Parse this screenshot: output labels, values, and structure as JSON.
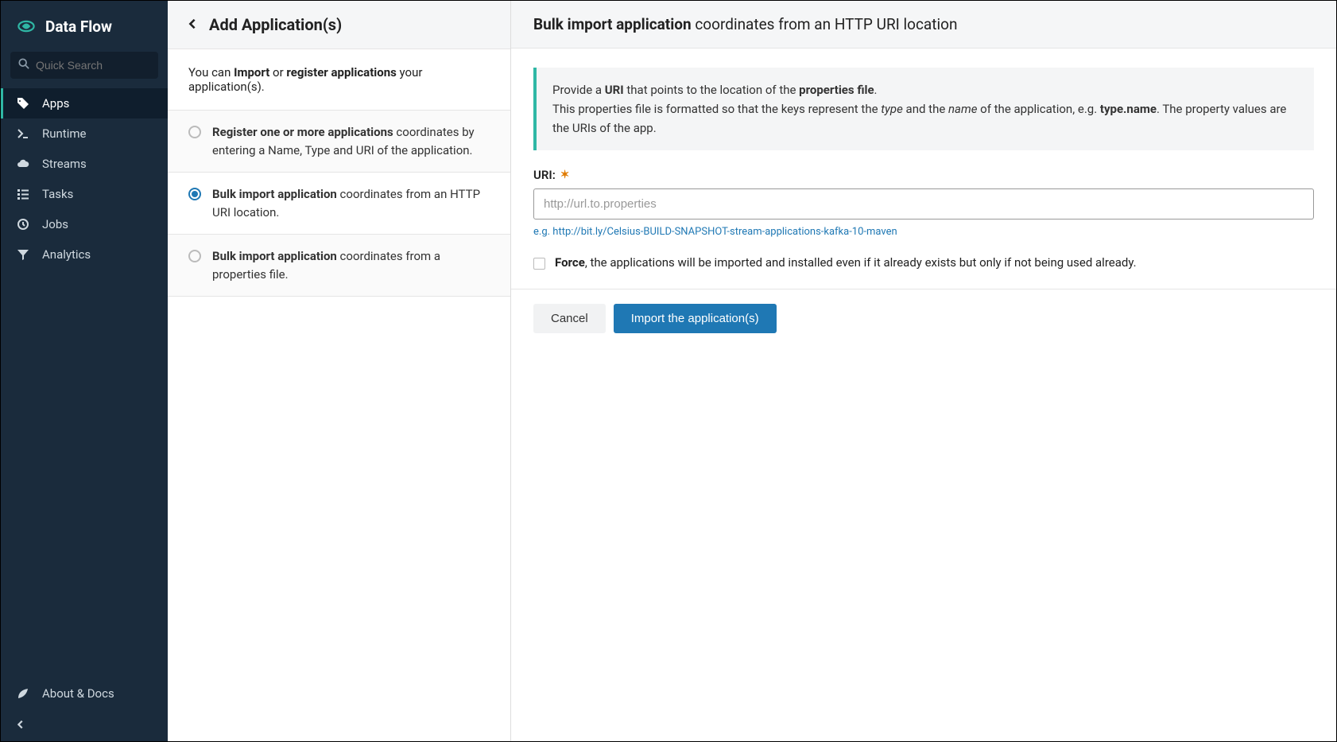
{
  "sidebar": {
    "title": "Data Flow",
    "search_placeholder": "Quick Search",
    "nav": [
      {
        "label": "Apps",
        "icon": "tags"
      },
      {
        "label": "Runtime",
        "icon": "prompt"
      },
      {
        "label": "Streams",
        "icon": "cloud"
      },
      {
        "label": "Tasks",
        "icon": "list"
      },
      {
        "label": "Jobs",
        "icon": "clock"
      },
      {
        "label": "Analytics",
        "icon": "filter"
      }
    ],
    "footer": {
      "label": "About & Docs"
    }
  },
  "left": {
    "title": "Add Application(s)",
    "intro_prefix": "You can ",
    "intro_bold1": "Import",
    "intro_mid": " or ",
    "intro_bold2": "register applications",
    "intro_suffix": " your application(s).",
    "options": [
      {
        "bold": "Register one or more applications",
        "rest": " coordinates by entering a Name, Type and URI of the application."
      },
      {
        "bold": "Bulk import application",
        "rest": " coordinates from an HTTP URI location."
      },
      {
        "bold": "Bulk import application",
        "rest": " coordinates from a properties file."
      }
    ]
  },
  "right": {
    "header_bold": "Bulk import application",
    "header_rest": " coordinates from an HTTP URI location",
    "info_p1_a": "Provide a ",
    "info_p1_b": "URI",
    "info_p1_c": " that points to the location of the ",
    "info_p1_d": "properties file",
    "info_p1_e": ".",
    "info_p2_a": "This properties file is formatted so that the keys represent the ",
    "info_p2_b": "type",
    "info_p2_c": " and the ",
    "info_p2_d": "name",
    "info_p2_e": " of the application, e.g. ",
    "info_p2_f": "type.name",
    "info_p2_g": ". The property values are the URIs of the app.",
    "uri_label": "URI:",
    "uri_placeholder": "http://url.to.properties",
    "hint_prefix": "e.g. ",
    "hint_link": "http://bit.ly/Celsius-BUILD-SNAPSHOT-stream-applications-kafka-10-maven",
    "force_bold": "Force",
    "force_rest": ", the applications will be imported and installed even if it already exists but only if not being used already.",
    "cancel": "Cancel",
    "submit": "Import the application(s)"
  }
}
